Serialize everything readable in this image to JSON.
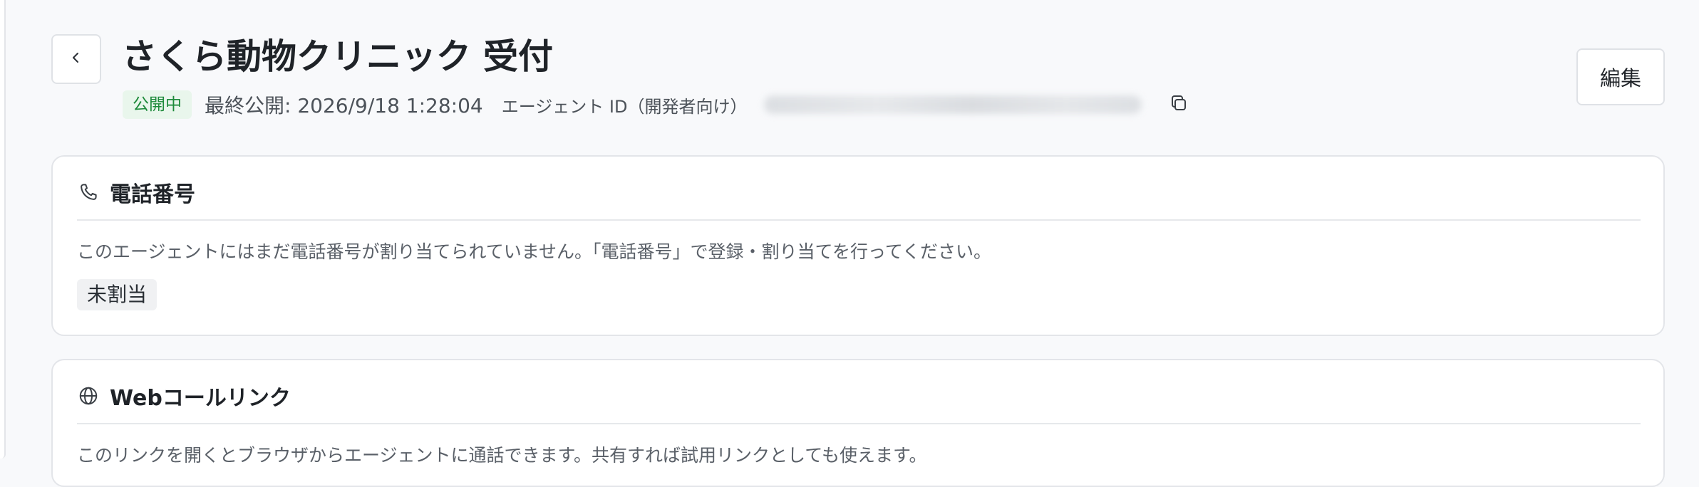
{
  "header": {
    "title": "さくら動物クリニック 受付",
    "status_badge": "公開中",
    "last_published": "最終公開: 2026/9/18 1:28:04",
    "agent_id_label": "エージェント ID（開発者向け）",
    "edit_label": "編集"
  },
  "phone_card": {
    "title": "電話番号",
    "description": "このエージェントにはまだ電話番号が割り当てられていません。「電話番号」で登録・割り当てを行ってください。",
    "status_badge": "未割当"
  },
  "web_card": {
    "title": "Webコールリンク",
    "description": "このリンクを開くとブラウザからエージェントに通話できます。共有すれば試用リンクとしても使えます。"
  },
  "colors": {
    "status_badge_bg": "#e9f6ec",
    "status_badge_text": "#1d8a3a",
    "page_bg": "#f8f9fb",
    "card_border": "#e3e5e9"
  },
  "icons": {
    "back": "chevron-left-icon",
    "copy": "copy-icon",
    "phone": "phone-icon",
    "web": "globe-icon"
  }
}
